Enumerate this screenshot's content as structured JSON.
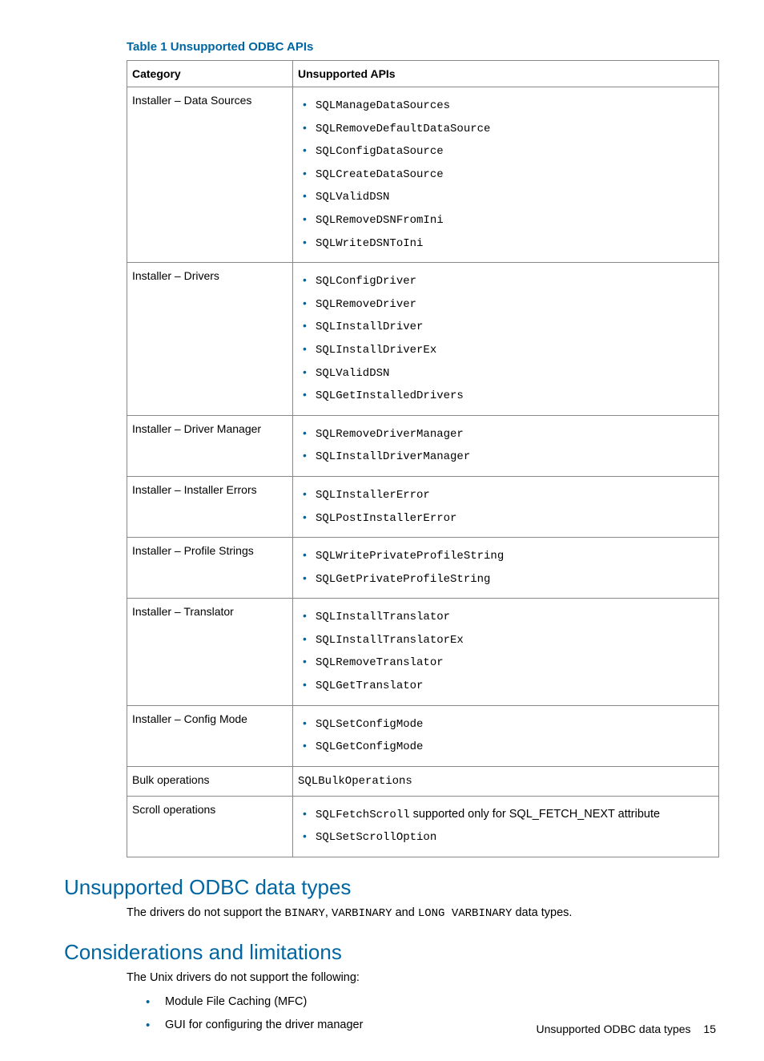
{
  "table": {
    "title": "Table 1 Unsupported ODBC APIs",
    "header_category": "Category",
    "header_apis": "Unsupported APIs",
    "rows": [
      {
        "category": "Installer – Data Sources",
        "apis": [
          {
            "text": "SQLManageDataSources",
            "mono": true
          },
          {
            "text": "SQLRemoveDefaultDataSource",
            "mono": true
          },
          {
            "text": "SQLConfigDataSource",
            "mono": true
          },
          {
            "text": "SQLCreateDataSource",
            "mono": true
          },
          {
            "text": "SQLValidDSN",
            "mono": true
          },
          {
            "text": "SQLRemoveDSNFromIni",
            "mono": true
          },
          {
            "text": "SQLWriteDSNToIni",
            "mono": true
          }
        ]
      },
      {
        "category": "Installer – Drivers",
        "apis": [
          {
            "text": "SQLConfigDriver",
            "mono": true
          },
          {
            "text": "SQLRemoveDriver",
            "mono": true
          },
          {
            "text": "SQLInstallDriver",
            "mono": true
          },
          {
            "text": "SQLInstallDriverEx",
            "mono": true
          },
          {
            "text": "SQLValidDSN",
            "mono": true
          },
          {
            "text": "SQLGetInstalledDrivers",
            "mono": true
          }
        ]
      },
      {
        "category": "Installer – Driver Manager",
        "apis": [
          {
            "text": "SQLRemoveDriverManager",
            "mono": true
          },
          {
            "text": "SQLInstallDriverManager",
            "mono": true
          }
        ]
      },
      {
        "category": "Installer – Installer Errors",
        "apis": [
          {
            "text": "SQLInstallerError",
            "mono": true
          },
          {
            "text": "SQLPostInstallerError",
            "mono": true
          }
        ]
      },
      {
        "category": "Installer – Profile Strings",
        "apis": [
          {
            "text": "SQLWritePrivateProfileString",
            "mono": true
          },
          {
            "text": "SQLGetPrivateProfileString",
            "mono": true
          }
        ]
      },
      {
        "category": "Installer – Translator",
        "apis": [
          {
            "text": "SQLInstallTranslator",
            "mono": true
          },
          {
            "text": "SQLInstallTranslatorEx",
            "mono": true
          },
          {
            "text": "SQLRemoveTranslator",
            "mono": true
          },
          {
            "text": "SQLGetTranslator",
            "mono": true
          }
        ]
      },
      {
        "category": "Installer – Config Mode",
        "apis": [
          {
            "text": "SQLSetConfigMode",
            "mono": true
          },
          {
            "text": "SQLGetConfigMode",
            "mono": true
          }
        ]
      },
      {
        "category": "Bulk operations",
        "plain": {
          "text": "SQLBulkOperations",
          "mono": true
        }
      },
      {
        "category": "Scroll operations",
        "apis": [
          {
            "pre": "SQLFetchScroll",
            "suffix": " supported only for SQL_FETCH_NEXT attribute"
          },
          {
            "text": "SQLSetScrollOption",
            "mono": true
          }
        ]
      }
    ]
  },
  "section1": {
    "heading": "Unsupported ODBC data types",
    "para_pre": "The drivers do not support the ",
    "t1": "BINARY",
    "sep1": ", ",
    "t2": "VARBINARY",
    "sep2": " and ",
    "t3": "LONG VARBINARY",
    "para_post": " data types."
  },
  "section2": {
    "heading": "Considerations and limitations",
    "para": "The Unix drivers do not support the following:",
    "items": [
      "Module File Caching (MFC)",
      "GUI for configuring the driver manager"
    ]
  },
  "footer": {
    "text": "Unsupported ODBC data types",
    "page": "15"
  }
}
